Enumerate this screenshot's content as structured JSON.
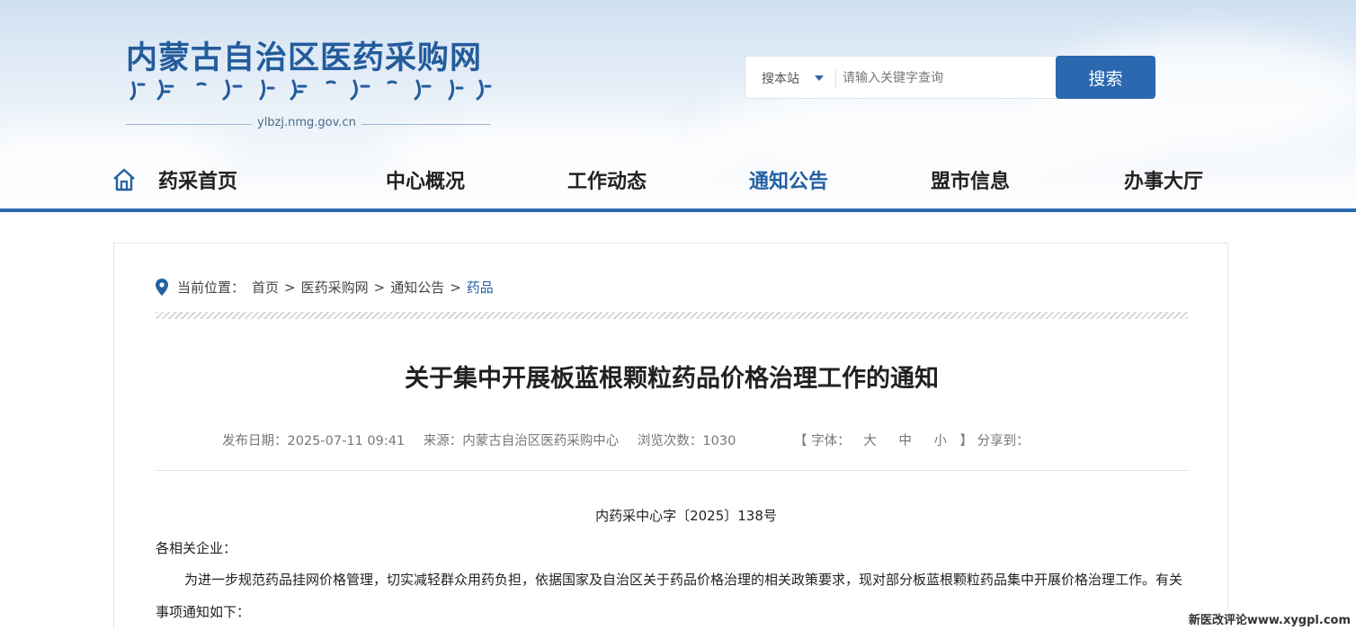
{
  "header": {
    "site_title": "内蒙古自治区医药采购网",
    "site_url": "ylbzj.nmg.gov.cn",
    "brand_color": "#2b68b0"
  },
  "search": {
    "scope": "搜本站",
    "placeholder": "请输入关键字查询",
    "button": "搜索"
  },
  "nav": {
    "items": [
      "药采首页",
      "中心概况",
      "工作动态",
      "通知公告",
      "盟市信息",
      "办事大厅"
    ],
    "active": "通知公告"
  },
  "breadcrumb": {
    "label": "当前位置：",
    "items": [
      "首页",
      "医药采购网",
      "通知公告",
      "药品"
    ],
    "separator": ">"
  },
  "article": {
    "title": "关于集中开展板蓝根颗粒药品价格治理工作的通知",
    "meta": {
      "date": "发布日期：2025-07-11 09:41",
      "source": "来源：内蒙古自治区医药采购中心",
      "views": "浏览次数：1030"
    },
    "font_control": {
      "open": "【",
      "label": "字体：",
      "large": "大",
      "medium": "中",
      "small": "小",
      "close": "】",
      "share": "分享到："
    },
    "doc_number": "内药采中心字〔2025〕138号",
    "salutation": "各相关企业：",
    "paragraph": "为进一步规范药品挂网价格管理，切实减轻群众用药负担，依据国家及自治区关于药品价格治理的相关政策要求，现对部分板蓝根颗粒药品集中开展价格治理工作。有关事项通知如下："
  },
  "watermark": "新医改评论www.xygpl.com"
}
